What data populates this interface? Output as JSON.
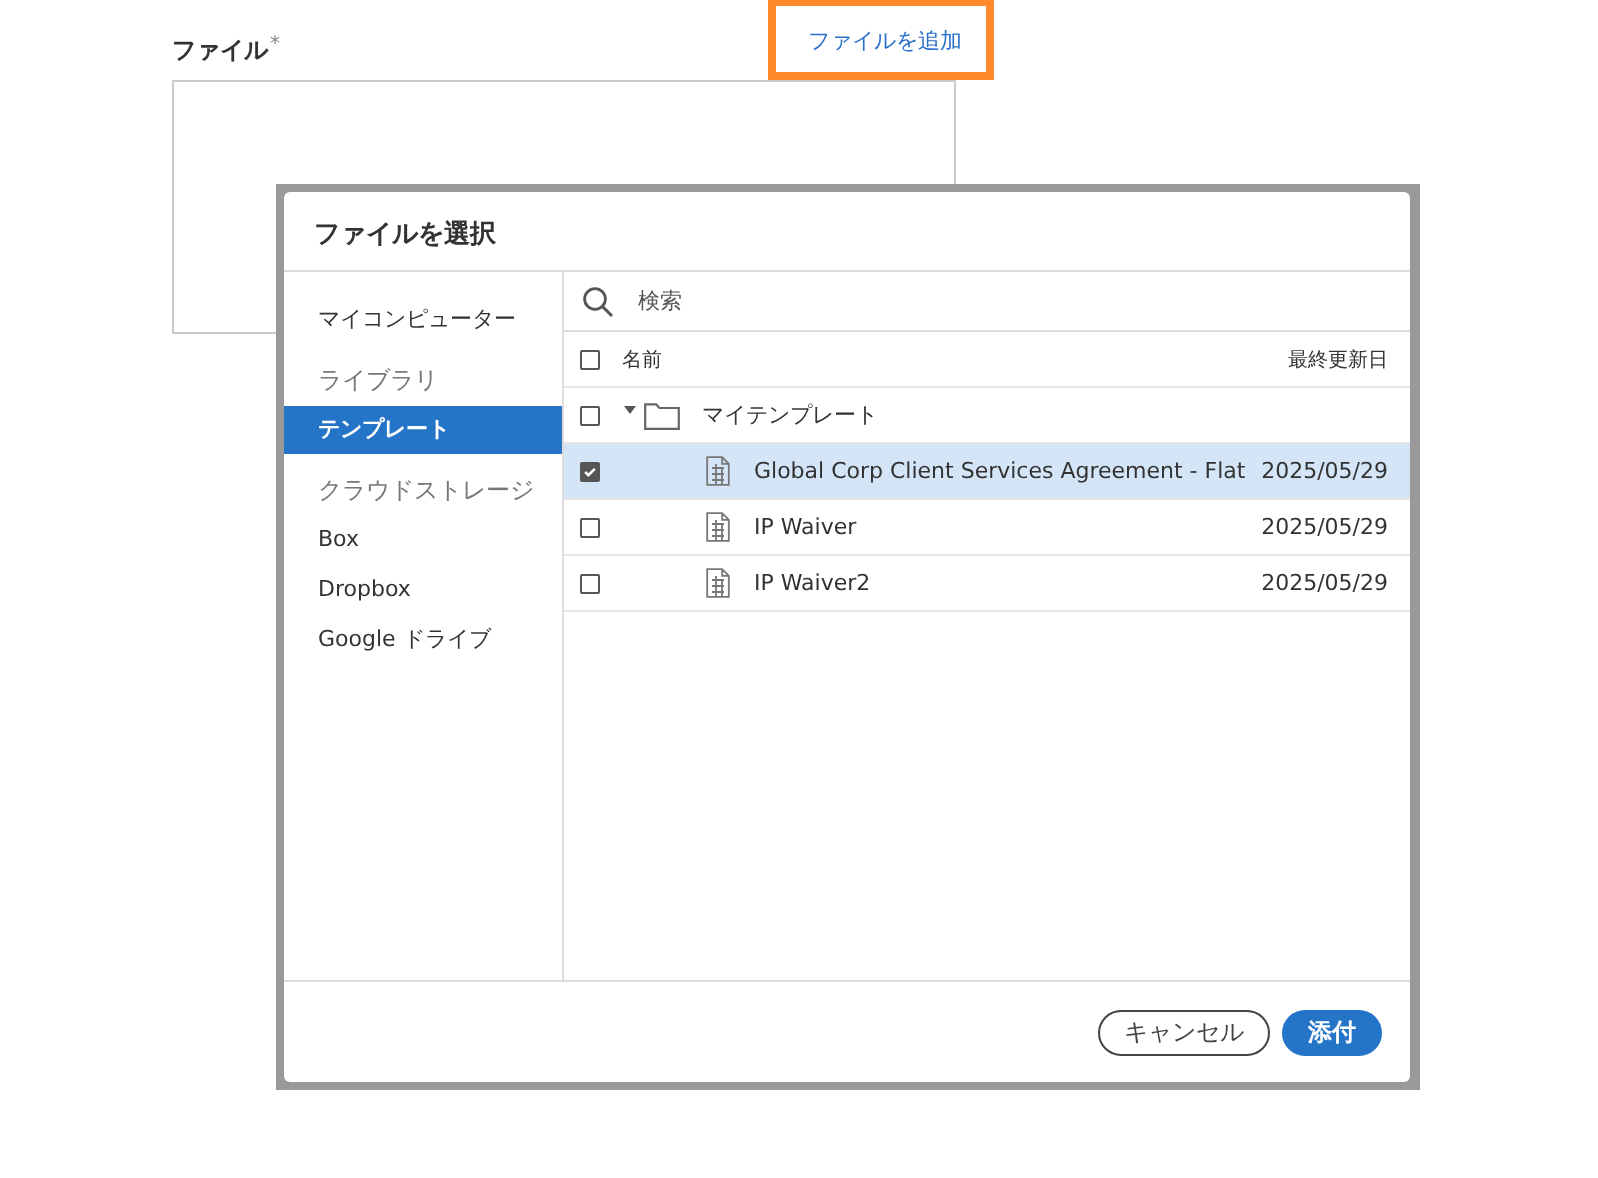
{
  "field": {
    "label": "ファイル",
    "required_mark": "*",
    "add_link": "ファイルを追加",
    "add_link_highlighted": true
  },
  "dialog": {
    "title": "ファイルを選択",
    "sidebar": [
      {
        "kind": "item",
        "label": "マイコンピューター",
        "selected": false
      },
      {
        "kind": "heading",
        "label": "ライブラリ"
      },
      {
        "kind": "item",
        "label": "テンプレート",
        "selected": true
      },
      {
        "kind": "heading",
        "label": "クラウドストレージ"
      },
      {
        "kind": "item",
        "label": "Box",
        "selected": false
      },
      {
        "kind": "item",
        "label": "Dropbox",
        "selected": false
      },
      {
        "kind": "item",
        "label": "Google ドライブ",
        "selected": false
      }
    ],
    "search": {
      "placeholder": "検索"
    },
    "columns": {
      "name": "名前",
      "modified": "最終更新日",
      "all_checked": false
    },
    "tree": [
      {
        "kind": "folder",
        "name": "マイテンプレート",
        "checked": false,
        "expanded": true,
        "children": [
          {
            "kind": "file",
            "name": "Global Corp Client Services Agreement - Flat",
            "modified": "2025/05/29",
            "checked": true,
            "selected": true
          },
          {
            "kind": "file",
            "name": "IP Waiver",
            "modified": "2025/05/29",
            "checked": false,
            "selected": false
          },
          {
            "kind": "file",
            "name": "IP Waiver2",
            "modified": "2025/05/29",
            "checked": false,
            "selected": false
          }
        ]
      }
    ],
    "buttons": {
      "cancel": "キャンセル",
      "attach": "添付"
    }
  }
}
